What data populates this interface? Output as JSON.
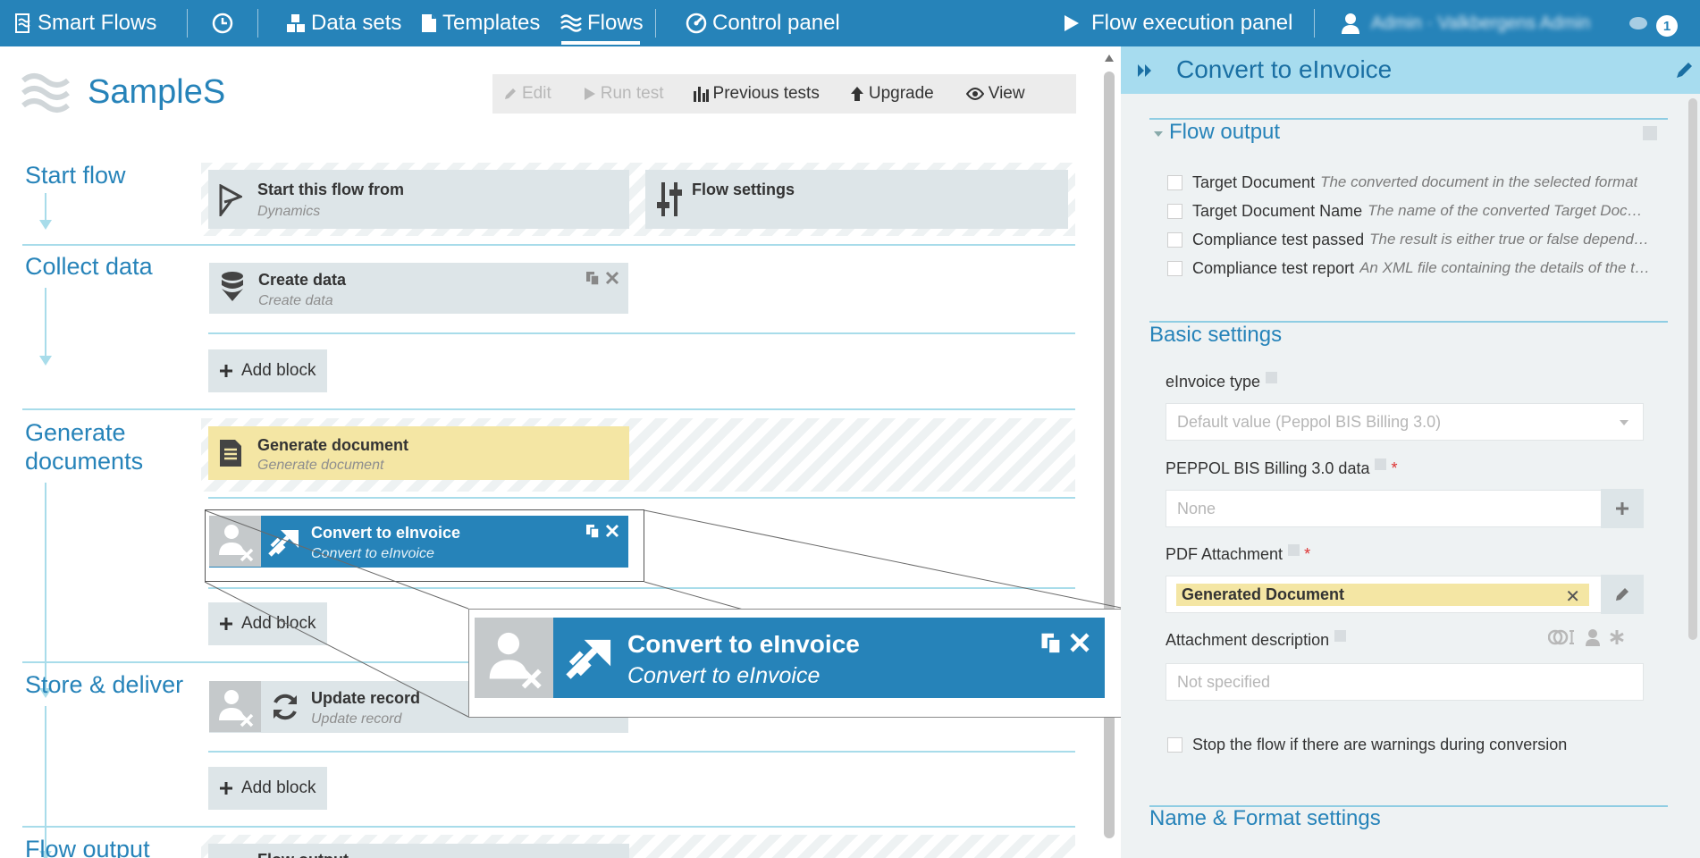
{
  "nav": {
    "brand": "Smart Flows",
    "datasets": "Data sets",
    "templates": "Templates",
    "flows": "Flows",
    "control_panel": "Control panel",
    "execution_panel": "Flow execution panel",
    "user": "Admin · Valkbergens Admin",
    "notifications": "1"
  },
  "flow": {
    "title": "SampleS",
    "toolbar": {
      "edit": "Edit",
      "run_test": "Run test",
      "previous_tests": "Previous tests",
      "upgrade": "Upgrade",
      "view": "View"
    }
  },
  "sections": {
    "start_flow": "Start flow",
    "collect_data": "Collect data",
    "generate_line1": "Generate",
    "generate_line2": "documents",
    "store_deliver": "Store & deliver",
    "flow_output": "Flow output"
  },
  "blocks": {
    "start": {
      "title": "Start this flow from",
      "subtitle": "Dynamics"
    },
    "settings": {
      "title": "Flow settings"
    },
    "create": {
      "title": "Create data",
      "subtitle": "Create data"
    },
    "generate": {
      "title": "Generate document",
      "subtitle": "Generate document"
    },
    "convert": {
      "title": "Convert to eInvoice",
      "subtitle": "Convert to eInvoice"
    },
    "update": {
      "title": "Update record",
      "subtitle": "Update record"
    },
    "flow_output": {
      "title": "Flow output"
    },
    "add_block": "Add block"
  },
  "panel": {
    "title": "Convert to eInvoice",
    "flow_output": {
      "heading": "Flow output",
      "items": [
        {
          "label": "Target Document",
          "desc": "The converted document in the selected format"
        },
        {
          "label": "Target Document Name",
          "desc": "The name of the converted Target Document"
        },
        {
          "label": "Compliance test passed",
          "desc": "The result is either true or false depending on the test"
        },
        {
          "label": "Compliance test report",
          "desc": "An XML file containing the details of the test"
        }
      ]
    },
    "basic": {
      "heading": "Basic settings",
      "einvoice_type_label": "eInvoice type",
      "einvoice_type_value": "Default value (Peppol BIS Billing 3.0)",
      "peppol_label": "PEPPOL BIS Billing 3.0 data",
      "peppol_value": "None",
      "pdf_label": "PDF Attachment",
      "pdf_value": "Generated Document",
      "attach_desc_label": "Attachment description",
      "attach_desc_placeholder": "Not specified",
      "stop_label": "Stop the flow if there are warnings during conversion"
    },
    "name_format_heading": "Name & Format settings"
  },
  "colors": {
    "accent": "#2683b9",
    "panel_header": "#a7dcef",
    "highlight": "#f4e6a4",
    "line": "#a8dcea"
  }
}
